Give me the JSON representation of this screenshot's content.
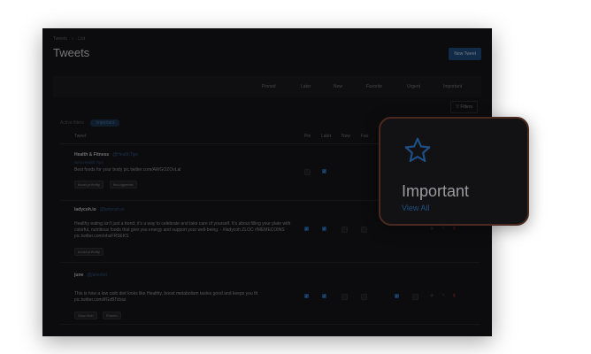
{
  "breadcrumb": {
    "home": "Tweets",
    "current": "List"
  },
  "page": {
    "title": "Tweets",
    "new_button": "New Tweet"
  },
  "tabs": [
    "Pinned",
    "Later",
    "Now",
    "Favorite",
    "Urgent",
    "Important"
  ],
  "filters_button": "Filters",
  "active_filters": {
    "label": "Active filters",
    "pill": "Important"
  },
  "table": {
    "columns": [
      "Tweet",
      "Pin",
      "Later",
      "Now",
      "Fav"
    ]
  },
  "rows": [
    {
      "author": "Health & Fitness",
      "handle": "@HealthTips",
      "sub": "Best Health Tips",
      "body": "Best foods for your body pic.twitter.com/AWGOZOvLal",
      "tags": [
        "boost.yr.thrifty",
        "find.dgsense"
      ],
      "pin": false,
      "later": true
    },
    {
      "author": "ladycoh.io",
      "handle": "@ladycoh.io",
      "sub": "",
      "body": "Healthy eating isn't just a trend; it's a way to celebrate and take care of yourself. It's about filling your plate with colorful, nutritious foods that give you energy and support your well-being. - #ladycoh ZLOC #MEMECOINS pic.twitter.com/ohaFRSEKS",
      "tags": [
        "boost.yr.thrifty"
      ],
      "pin": true,
      "later": true
    },
    {
      "author": "june",
      "handle": "@junediet",
      "sub": "",
      "body": "This is how a low carb diet looks like Healthy, boost metabolism tastes good and keeps you fit pic.twitter.com/ifGzBTcbaz",
      "tags": [
        "Slow Vich",
        "Protein"
      ],
      "pin": true,
      "later": true
    }
  ],
  "callout": {
    "title": "Important",
    "link": "View All"
  }
}
